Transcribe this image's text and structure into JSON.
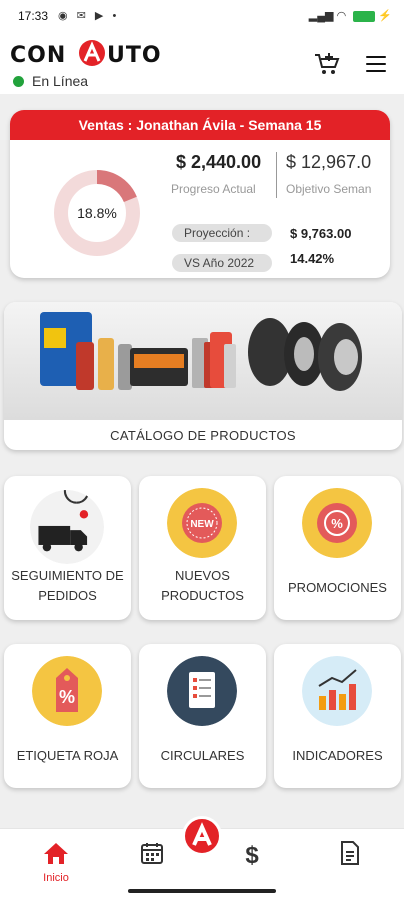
{
  "status_bar": {
    "time": "17:33"
  },
  "header": {
    "brand": "CONAUTO",
    "status": "En Línea"
  },
  "sales": {
    "title": "Ventas : Jonathan Ávila  -  Semana 15",
    "percent": "18.8%",
    "progress_value": "$ 2,440.00",
    "progress_label": "Progreso Actual",
    "objective_value": "$ 12,967.0",
    "objective_label": "Objetivo Seman",
    "projection_label": "Proyección :",
    "projection_value": "$ 9,763.00",
    "vs_label": "VS Año 2022 :",
    "vs_value": "14.42%",
    "progress_fraction": 0.188
  },
  "catalog": {
    "label": "CATÁLOGO DE PRODUCTOS"
  },
  "tiles": [
    {
      "label": "SEGUIMIENTO DE PEDIDOS",
      "icon": "delivery-truck-icon"
    },
    {
      "label": "NUEVOS PRODUCTOS",
      "icon": "new-badge-icon",
      "badge": "NEW"
    },
    {
      "label": "PROMOCIONES",
      "icon": "percent-badge-icon"
    },
    {
      "label": "ETIQUETA ROJA",
      "icon": "price-tag-icon"
    },
    {
      "label": "CIRCULARES",
      "icon": "document-list-icon"
    },
    {
      "label": "INDICADORES",
      "icon": "bar-chart-icon"
    }
  ],
  "bottom_nav": {
    "home_label": "Inicio"
  },
  "colors": {
    "accent": "#e32227",
    "online": "#22a23c",
    "tile_yellow": "#f4c542",
    "tile_dark": "#34495e",
    "tile_light_blue": "#d6ecf7"
  }
}
